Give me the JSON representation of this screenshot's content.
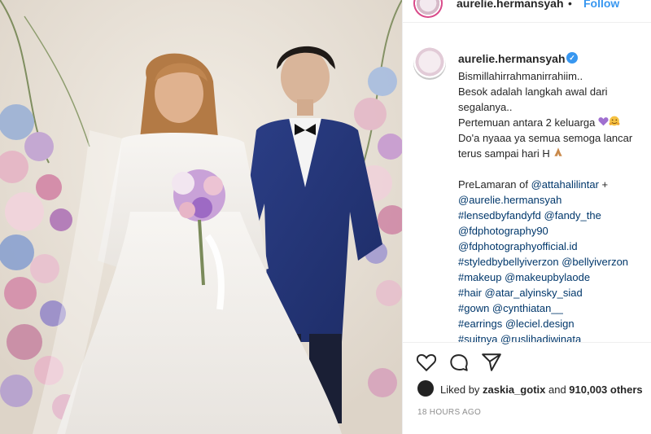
{
  "colors": {
    "link": "#00376b",
    "follow": "#3897f0",
    "verified": "#3897f0",
    "text": "#262626",
    "muted": "#8e8e8e"
  },
  "header": {
    "username": "aurelie.hermansyah",
    "separator": "•",
    "follow_label": "Follow"
  },
  "post": {
    "username": "aurelie.hermansyah",
    "verified_mark": "✓",
    "caption": {
      "l1": "Bismillahirrahmanirrahiim..",
      "l2": "Besok adalah langkah awal dari",
      "l3": "segalanya..",
      "l4": "Pertemuan antara 2 keluarga ",
      "l5": "Do'a nyaaa ya semua semoga lancar",
      "l6": "terus sampai hari H ",
      "l7_prefix": "PreLamaran of ",
      "l7_link": "@attahalilintar",
      "l7_suffix": " +",
      "l8": "@aurelie.hermansyah",
      "l9": "#lensedbyfandyfd",
      "l9b": " @fandy_the",
      "l10": "@fdphotography90",
      "l11": "@fdphotographyofficial.id",
      "l12": "#styledbybellyiverzon",
      "l12b": " @bellyiverzon",
      "l13": "#makeup",
      "l13b": " @makeupbylaode",
      "l14": "#hair",
      "l14b": " @atar_alyinsky_siad",
      "l15": "#gown",
      "l15b": " @cynthiatan__",
      "l16": "#earrings",
      "l16b": " @leciel.design",
      "l17": "#suitnya",
      "l17b": " @ruslihadiwinata"
    },
    "emoji": {
      "heart": "purple-heart-icon",
      "hug": "hugging-face-icon",
      "pray": "folded-hands-icon"
    },
    "liked_prefix": "Liked by ",
    "liked_user": "zaskia_gotix",
    "liked_mid": " and ",
    "liked_count": "910,003",
    "liked_suffix": " others",
    "timestamp": "18 HOURS AGO"
  }
}
